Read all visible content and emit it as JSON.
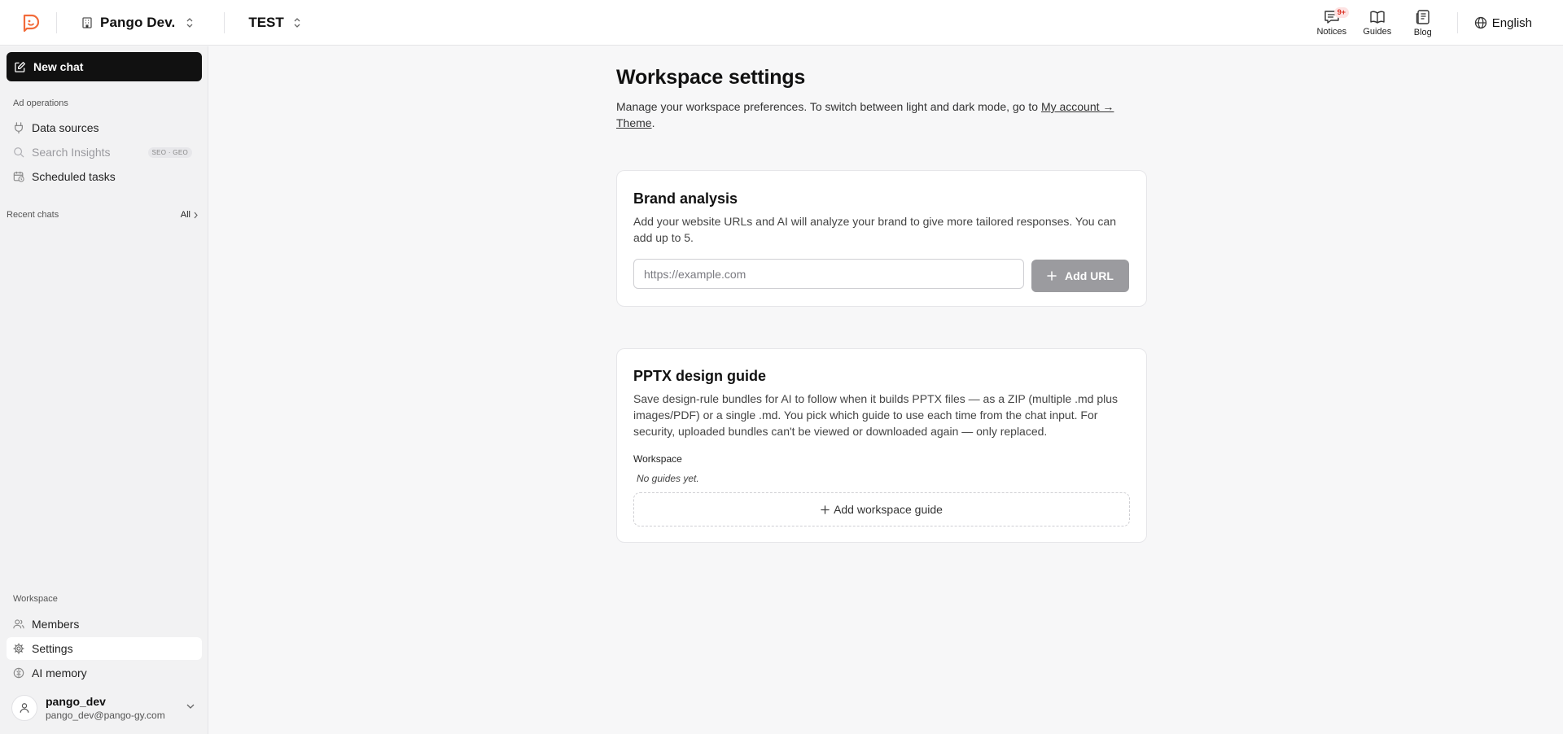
{
  "header": {
    "workspace_name": "Pango Dev.",
    "project_name": "TEST",
    "nav": [
      {
        "label": "Notices",
        "icon": "notices-icon",
        "badge": "9+"
      },
      {
        "label": "Guides",
        "icon": "book-icon"
      },
      {
        "label": "Blog",
        "icon": "blog-icon"
      }
    ],
    "language": "English"
  },
  "sidebar": {
    "new_chat_label": "New chat",
    "ad_operations_label": "Ad operations",
    "items": [
      {
        "label": "Data sources",
        "icon": "plug-icon",
        "enabled": true
      },
      {
        "label": "Search Insights",
        "icon": "search-icon",
        "enabled": false,
        "tag": "SEO · GEO"
      },
      {
        "label": "Scheduled tasks",
        "icon": "calendar-clock-icon",
        "enabled": true
      }
    ],
    "recent_chats_label": "Recent chats",
    "recent_all_label": "All",
    "workspace_label": "Workspace",
    "workspace_items": [
      {
        "label": "Members",
        "icon": "users-icon",
        "active": false
      },
      {
        "label": "Settings",
        "icon": "gear-icon",
        "active": true
      },
      {
        "label": "AI memory",
        "icon": "brain-icon",
        "active": false
      }
    ],
    "user": {
      "name": "pango_dev",
      "email": "pango_dev@pango-gy.com"
    }
  },
  "main": {
    "title": "Workspace settings",
    "description_prefix": "Manage your workspace preferences. To switch between light and dark mode, go to ",
    "description_link": "My account → Theme",
    "description_suffix": ".",
    "brand_analysis": {
      "title": "Brand analysis",
      "description": "Add your website URLs and AI will analyze your brand to give more tailored responses. You can add up to 5.",
      "input_placeholder": "https://example.com",
      "input_value": "",
      "add_button": "Add URL"
    },
    "pptx_guide": {
      "title": "PPTX design guide",
      "description": "Save design-rule bundles for AI to follow when it builds PPTX files — as a ZIP (multiple .md plus images/PDF) or a single .md. You pick which guide to use each time from the chat input. For security, uploaded bundles can't be viewed or downloaded again — only replaced.",
      "section_label": "Workspace",
      "empty_text": "No guides yet.",
      "add_button": "Add workspace guide"
    }
  },
  "colors": {
    "accent": "#f26b3a",
    "primary_button": "#111111",
    "disabled_button": "#9b9b9f",
    "badge_text": "#d92d20"
  }
}
